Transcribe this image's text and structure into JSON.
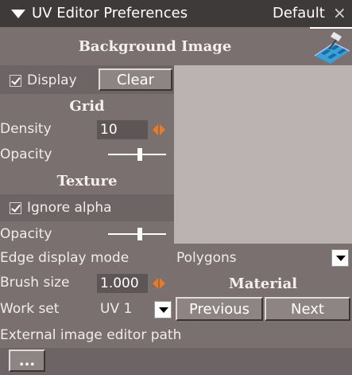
{
  "window": {
    "title": "UV Editor Preferences",
    "preset": "Default",
    "close_glyph": "×"
  },
  "background_image": {
    "header": "Background Image",
    "display_label": "Display",
    "display_checked": true,
    "clear_label": "Clear"
  },
  "grid": {
    "header": "Grid",
    "density_label": "Density",
    "density_value": "10",
    "opacity_label": "Opacity",
    "opacity_level": 0.55
  },
  "texture": {
    "header": "Texture",
    "ignore_alpha_label": "Ignore alpha",
    "ignore_alpha_checked": true,
    "opacity_label": "Opacity",
    "opacity_level": 0.55
  },
  "edge_display": {
    "label": "Edge display mode",
    "value": "Polygons"
  },
  "brush": {
    "label": "Brush size",
    "value": "1.000"
  },
  "material": {
    "header": "Material",
    "previous_label": "Previous",
    "next_label": "Next"
  },
  "work_set": {
    "label": "Work set",
    "value": "UV 1"
  },
  "external_editor": {
    "label": "External image editor path",
    "browse_label": "..."
  },
  "colors": {
    "panel": "#7a7070",
    "panel_alt": "#6d6565",
    "preview": "#bbb2b2",
    "accent": "#f07820"
  }
}
